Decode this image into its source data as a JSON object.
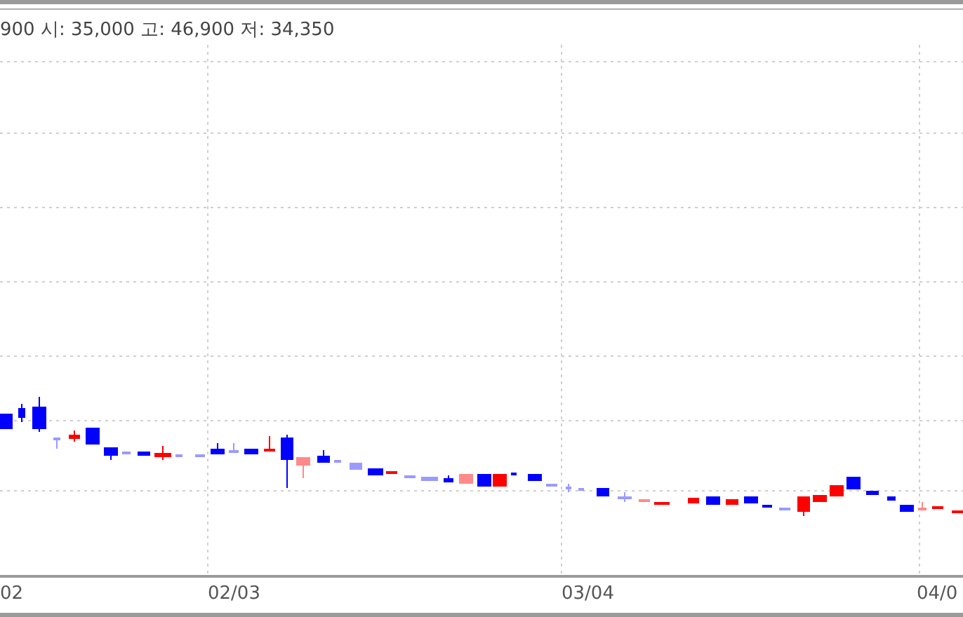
{
  "header": {
    "text": "900 시: 35,000 고: 46,900 저: 34,350"
  },
  "chart": {
    "x_labels": [
      "02",
      "02/03",
      "03/04",
      "04/0"
    ]
  }
}
